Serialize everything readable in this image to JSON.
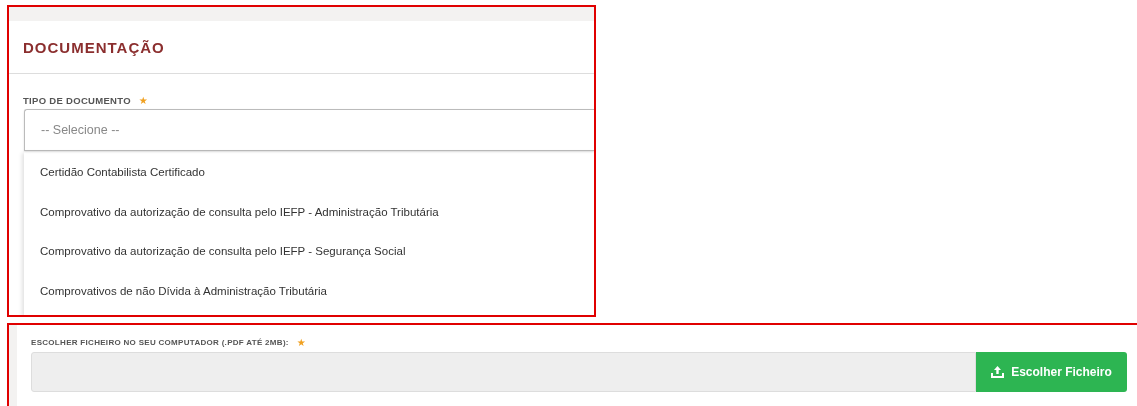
{
  "section": {
    "title": "DOCUMENTAÇÃO"
  },
  "document_type": {
    "label": "TIPO DE DOCUMENTO",
    "required_mark": "★",
    "placeholder": "-- Selecione --",
    "expanded": true,
    "options": [
      {
        "label": "Certidão Contabilista Certificado",
        "selected": false
      },
      {
        "label": "Comprovativo da autorização de consulta pelo IEFP - Administração Tributária",
        "selected": false
      },
      {
        "label": "Comprovativo da autorização de consulta pelo IEFP - Segurança Social",
        "selected": false
      },
      {
        "label": "Comprovativos de não Dívida à Administração Tributária",
        "selected": false
      }
    ]
  },
  "file_upload": {
    "label": "ESCOLHER FICHEIRO NO SEU COMPUTADOR (.PDF ATÉ 2MB):",
    "required_mark": "★",
    "button": "Escolher Ficheiro"
  }
}
